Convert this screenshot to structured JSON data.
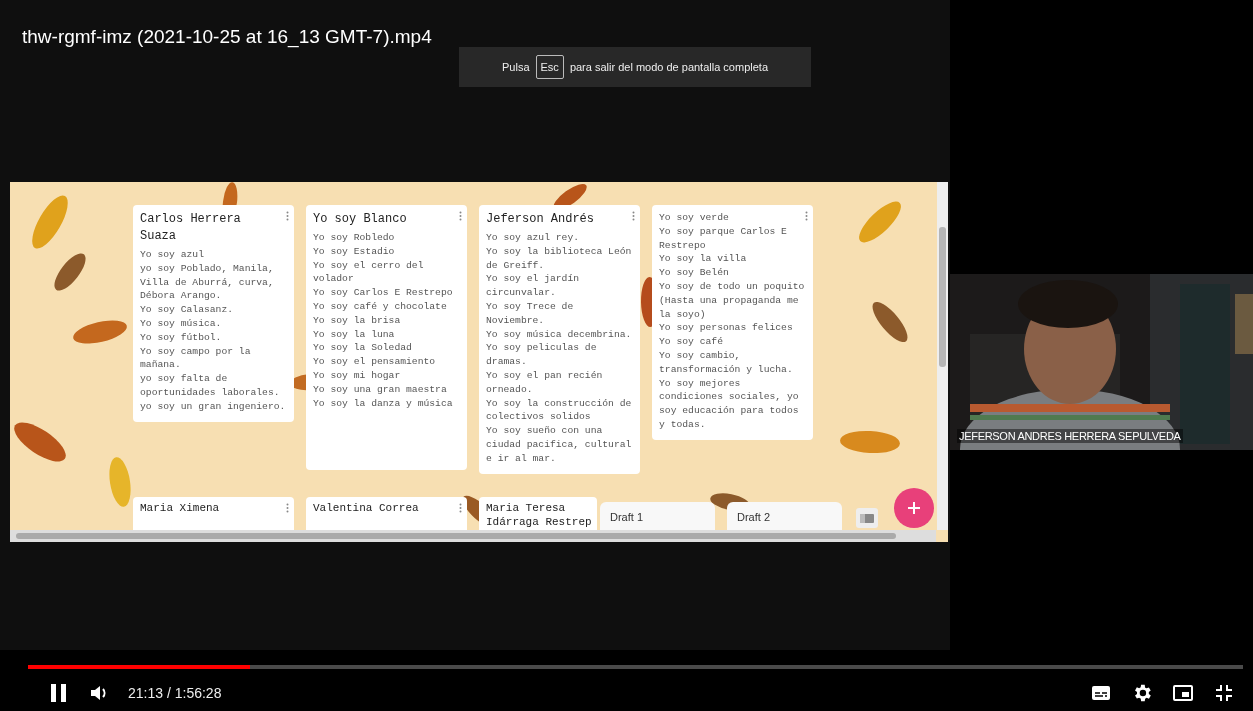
{
  "video": {
    "title": "thw-rgmf-imz (2021-10-25 at 16_13 GMT-7).mp4",
    "fullscreen_hint": {
      "before": "Pulsa",
      "key": "Esc",
      "after": "para salir del modo de pantalla completa"
    }
  },
  "board": {
    "cards": [
      {
        "title": "Carlos Herrera Suaza",
        "lines": [
          "Yo soy azul",
          "yo soy Poblado, Manila, Villa de Aburrá, curva, Débora Arango.",
          "Yo soy Calasanz.",
          "Yo soy música.",
          "Yo soy fútbol.",
          "Yo soy campo por la mañana.",
          "yo soy falta de oportunidades laborales.",
          "yo soy un gran ingeniero."
        ]
      },
      {
        "title": "Yo soy Blanco",
        "lines": [
          "Yo soy Robledo",
          "Yo soy Estadio",
          "Yo soy el cerro del volador",
          "Yo soy Carlos E Restrepo",
          "Yo soy café y chocolate",
          "Yo soy la brisa",
          "Yo soy la luna",
          "Yo soy la Soledad",
          "Yo soy el pensamiento",
          "Yo soy mi hogar",
          "Yo soy una gran maestra",
          "Yo soy la danza y música"
        ]
      },
      {
        "title": "Jeferson Andrés",
        "lines": [
          "Yo soy azul rey.",
          "Yo soy la biblioteca León de Greiff.",
          "Yo soy el jardín circunvalar.",
          "Yo soy Trece de Noviembre.",
          "Yo soy música decembrina.",
          "Yo soy peliculas de dramas.",
          "Yo soy el pan recién orneado.",
          "Yo soy la construcción de colectivos solidos",
          "Yo soy sueño con una ciudad pacifica, cultural e ir al mar."
        ]
      },
      {
        "lines": [
          "Yo soy verde",
          "Yo soy parque Carlos E Restrepo",
          "Yo soy la villa",
          "Yo soy Belén",
          "Yo soy de todo un poquito (Hasta una propaganda me la soyo)",
          "Yo soy personas felices",
          "Yo soy café",
          "Yo soy cambio, transformación y lucha.",
          "Yo soy mejores condiciones sociales, yo soy educación para todos y todas."
        ]
      }
    ],
    "next_cards": [
      {
        "title": "Maria Ximena"
      },
      {
        "title": "Valentina Correa"
      },
      {
        "title": "Maria Teresa Idárraga Restrep"
      }
    ],
    "drafts": [
      "Draft 1",
      "Draft 2"
    ]
  },
  "webcam": {
    "kind": "picture",
    "name": "JEFERSON ANDRES HERRERA SEPULVEDA"
  },
  "player": {
    "level": 0.183,
    "time": "21:13 / 1:56:28"
  }
}
